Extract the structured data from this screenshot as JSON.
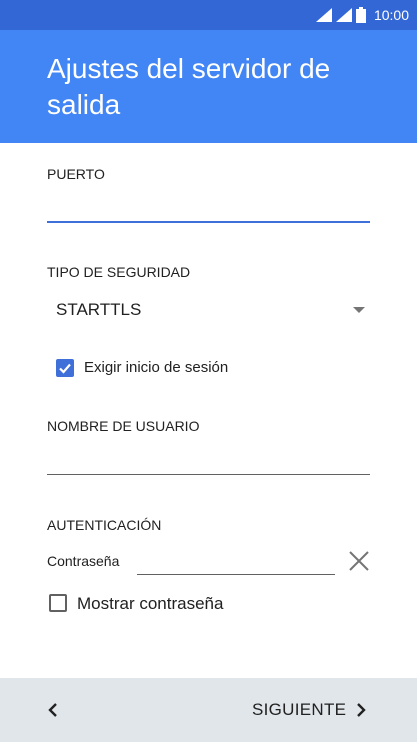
{
  "status_bar": {
    "time": "10:00"
  },
  "app_bar": {
    "title": "Ajustes del servidor de salida"
  },
  "form": {
    "port": {
      "label": "PUERTO",
      "value": ""
    },
    "security": {
      "label": "TIPO DE SEGURIDAD",
      "value": "STARTTLS"
    },
    "require_signin": {
      "label": "Exigir inicio de sesión",
      "checked": true
    },
    "username": {
      "label": "NOMBRE DE USUARIO",
      "value": ""
    },
    "authentication": {
      "label": "AUTENTICACIÓN",
      "password_label": "Contraseña",
      "password_value": ""
    },
    "show_password": {
      "label": "Mostrar contraseña",
      "checked": false
    }
  },
  "bottom_bar": {
    "next_label": "SIGUIENTE"
  },
  "colors": {
    "status_bar": "#3367d6",
    "app_bar": "#4285f4",
    "accent": "#3f6fd8",
    "bottom_bar": "#e1e6ea"
  },
  "icons": [
    "signal-icon",
    "battery-icon",
    "dropdown-arrow-icon",
    "check-icon",
    "close-icon",
    "chevron-left-icon",
    "chevron-right-icon"
  ]
}
